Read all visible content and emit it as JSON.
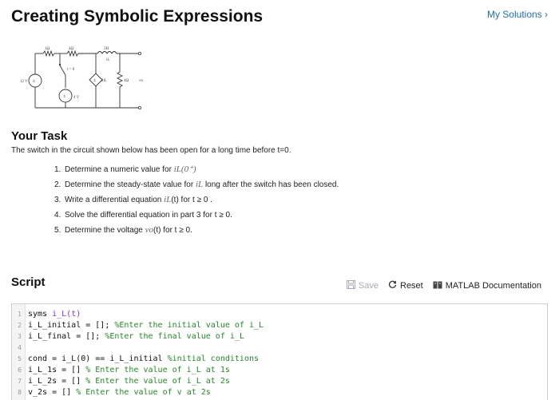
{
  "page": {
    "title": "Creating Symbolic Expressions",
    "my_solutions": "My Solutions ›"
  },
  "circuit": {
    "labels": {
      "r1": "1Ω",
      "r2": "4Ω",
      "l1": "2H",
      "il": "iL",
      "vs1": "12 V",
      "switch": "t = 0",
      "vs2": "4 V",
      "dep": "2iL",
      "r3": "4Ω",
      "vo": "vo"
    }
  },
  "task": {
    "heading": "Your Task",
    "description": "The switch in the circuit shown below has been open for a long time before t=0.",
    "steps": [
      {
        "num": "1.",
        "pre": "Determine a numeric value for ",
        "math": "iL(0⁺)",
        "post": ""
      },
      {
        "num": "2.",
        "pre": "Determine the steady-state value for ",
        "math": "iL",
        "post": " long after the switch has been closed."
      },
      {
        "num": "3.",
        "pre": "Write a differential equation ",
        "math": "iL",
        "post": "(t) for t ≥ 0 ."
      },
      {
        "num": "4.",
        "pre": "Solve the differential equation in part 3 for t ≥ 0.",
        "math": "",
        "post": ""
      },
      {
        "num": "5.",
        "pre": "Determine the voltage ",
        "math": "vo",
        "post": "(t)  for t ≥ 0."
      }
    ]
  },
  "script": {
    "heading": "Script",
    "save": "Save",
    "reset": "Reset",
    "docs": "MATLAB Documentation",
    "lines": [
      {
        "n": "1",
        "a": "syms ",
        "b": "i_L(t)",
        "c": ""
      },
      {
        "n": "2",
        "a": "i_L_initial = []; ",
        "b": "",
        "c": "%Enter the initial value of i_L"
      },
      {
        "n": "3",
        "a": "i_L_final = []; ",
        "b": "",
        "c": "%Enter the final value of i_L"
      },
      {
        "n": "4",
        "a": "",
        "b": "",
        "c": ""
      },
      {
        "n": "5",
        "a": "cond = i_L(0) == i_L_initial ",
        "b": "",
        "c": "%initial conditions"
      },
      {
        "n": "6",
        "a": "i_L_1s = [] ",
        "b": "",
        "c": "% Enter the value of i_L at 1s"
      },
      {
        "n": "7",
        "a": "i_L_2s = [] ",
        "b": "",
        "c": "% Enter the value of i_L at 2s"
      },
      {
        "n": "8",
        "a": "v_2s = [] ",
        "b": "",
        "c": "% Enter the value of v at 2s"
      }
    ]
  }
}
